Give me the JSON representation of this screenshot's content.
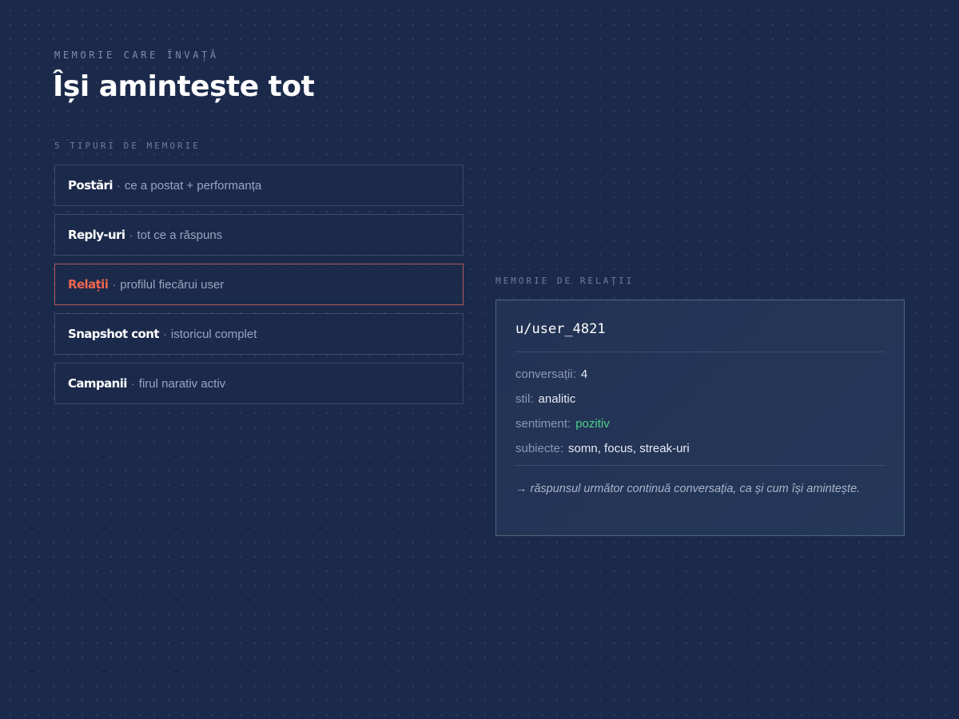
{
  "header": {
    "eyebrow": "MEMORIE CARE ÎNVAȚĂ",
    "title": "Își amintește tot"
  },
  "types_section": {
    "label": "5 TIPURI DE MEMORIE",
    "separator": "·",
    "items": [
      {
        "name": "Postări",
        "description": "ce a postat + performanța",
        "active": false
      },
      {
        "name": "Reply-uri",
        "description": "tot ce a răspuns",
        "active": false
      },
      {
        "name": "Relații",
        "description": "profilul fiecărui user",
        "active": true
      },
      {
        "name": "Snapshot cont",
        "description": "istoricul complet",
        "active": false
      },
      {
        "name": "Campanii",
        "description": "firul narativ activ",
        "active": false
      }
    ]
  },
  "relations_section": {
    "label": "MEMORIE DE RELAȚII",
    "card": {
      "username": "u/user_4821",
      "colon": ":",
      "fields": [
        {
          "label": "conversații",
          "value": "4",
          "color": "#e6ebf5"
        },
        {
          "label": "stil",
          "value": "analitic",
          "color": "#e6ebf5"
        },
        {
          "label": "sentiment",
          "value": "pozitiv",
          "color": "#4ed18a"
        },
        {
          "label": "subiecte",
          "value": "somn, focus, streak-uri",
          "color": "#e6ebf5"
        }
      ],
      "note": "→ răspunsul următor continuă conversația, ca și cum își amintește."
    }
  },
  "colors": {
    "background": "#1b2a4b",
    "accent": "#f0664f",
    "positive": "#4ed18a"
  }
}
